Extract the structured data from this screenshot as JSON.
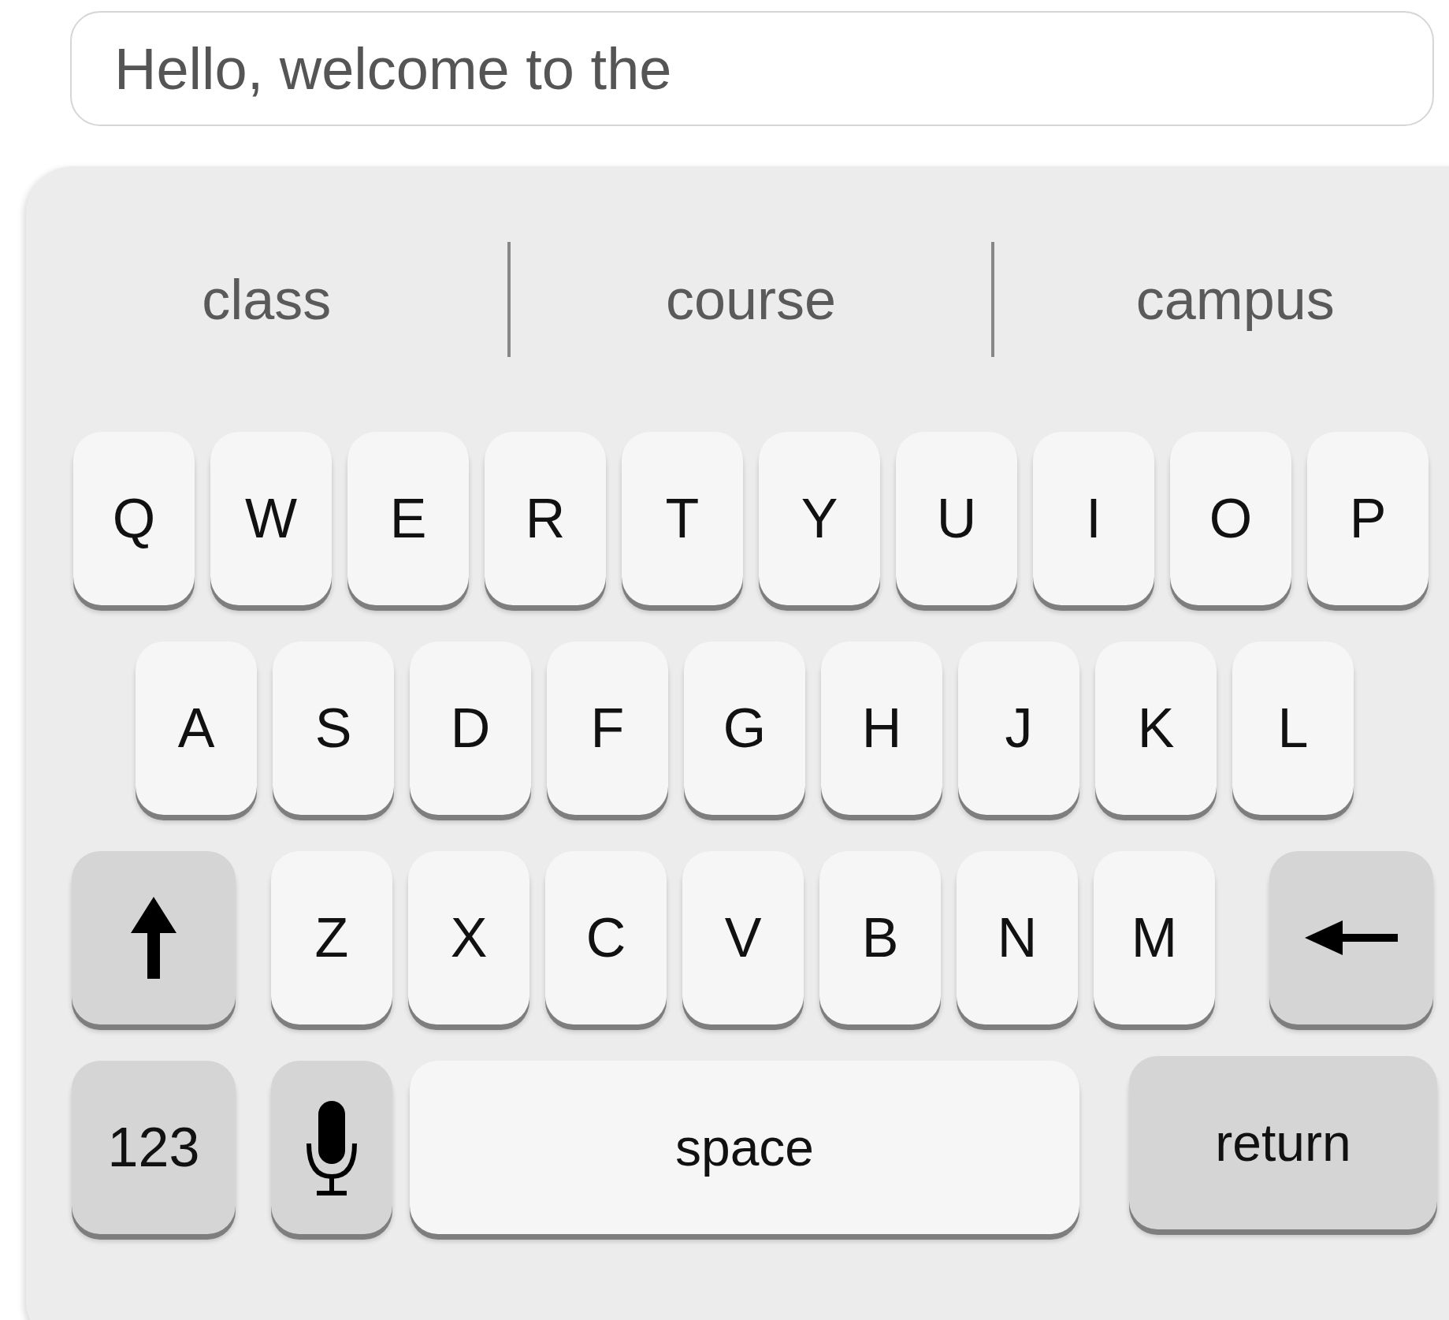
{
  "text_field": {
    "value": "Hello, welcome to the"
  },
  "suggestions": [
    "class",
    "course",
    "campus"
  ],
  "keyboard": {
    "rows": [
      {
        "keys": [
          {
            "kind": "letter",
            "label": "Q"
          },
          {
            "kind": "letter",
            "label": "W"
          },
          {
            "kind": "letter",
            "label": "E"
          },
          {
            "kind": "letter",
            "label": "R"
          },
          {
            "kind": "letter",
            "label": "T"
          },
          {
            "kind": "letter",
            "label": "Y"
          },
          {
            "kind": "letter",
            "label": "U"
          },
          {
            "kind": "letter",
            "label": "I"
          },
          {
            "kind": "letter",
            "label": "O"
          },
          {
            "kind": "letter",
            "label": "P"
          }
        ]
      },
      {
        "keys": [
          {
            "kind": "letter",
            "label": "A"
          },
          {
            "kind": "letter",
            "label": "S"
          },
          {
            "kind": "letter",
            "label": "D"
          },
          {
            "kind": "letter",
            "label": "F"
          },
          {
            "kind": "letter",
            "label": "G"
          },
          {
            "kind": "letter",
            "label": "H"
          },
          {
            "kind": "letter",
            "label": "J"
          },
          {
            "kind": "letter",
            "label": "K"
          },
          {
            "kind": "letter",
            "label": "L"
          }
        ]
      },
      {
        "keys": [
          {
            "kind": "shift"
          },
          {
            "kind": "letter",
            "label": "Z"
          },
          {
            "kind": "letter",
            "label": "X"
          },
          {
            "kind": "letter",
            "label": "C"
          },
          {
            "kind": "letter",
            "label": "V"
          },
          {
            "kind": "letter",
            "label": "B"
          },
          {
            "kind": "letter",
            "label": "N"
          },
          {
            "kind": "letter",
            "label": "M"
          },
          {
            "kind": "backspace"
          }
        ]
      },
      {
        "keys": [
          {
            "kind": "numbers",
            "label": "123"
          },
          {
            "kind": "mic"
          },
          {
            "kind": "space",
            "label": "space"
          },
          {
            "kind": "return",
            "label": "return"
          }
        ]
      }
    ]
  }
}
